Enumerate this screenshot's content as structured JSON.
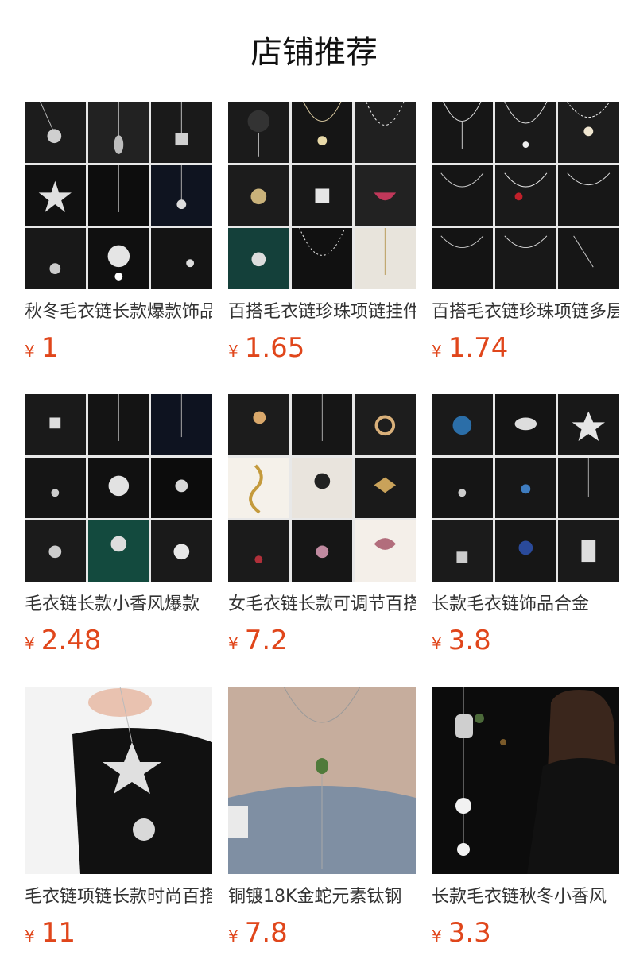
{
  "header": {
    "title": "店铺推荐"
  },
  "products": [
    {
      "name": "秋冬毛衣链长款爆款饰品",
      "currency": "¥",
      "price": "1"
    },
    {
      "name": "百搭毛衣链珍珠项链挂件",
      "currency": "¥",
      "price": "1.65"
    },
    {
      "name": "百搭毛衣链珍珠项链多层",
      "currency": "¥",
      "price": "1.74"
    },
    {
      "name": "毛衣链长款小香风爆款",
      "currency": "¥",
      "price": "2.48"
    },
    {
      "name": "女毛衣链长款可调节百搭",
      "currency": "¥",
      "price": "7.2"
    },
    {
      "name": "长款毛衣链饰品合金",
      "currency": "¥",
      "price": "3.8"
    },
    {
      "name": "毛衣链项链长款时尚百搭",
      "currency": "¥",
      "price": "11"
    },
    {
      "name": "铜镀18K金蛇元素钛钢",
      "currency": "¥",
      "price": "7.8"
    },
    {
      "name": "长款毛衣链秋冬小香风",
      "currency": "¥",
      "price": "3.3"
    }
  ]
}
